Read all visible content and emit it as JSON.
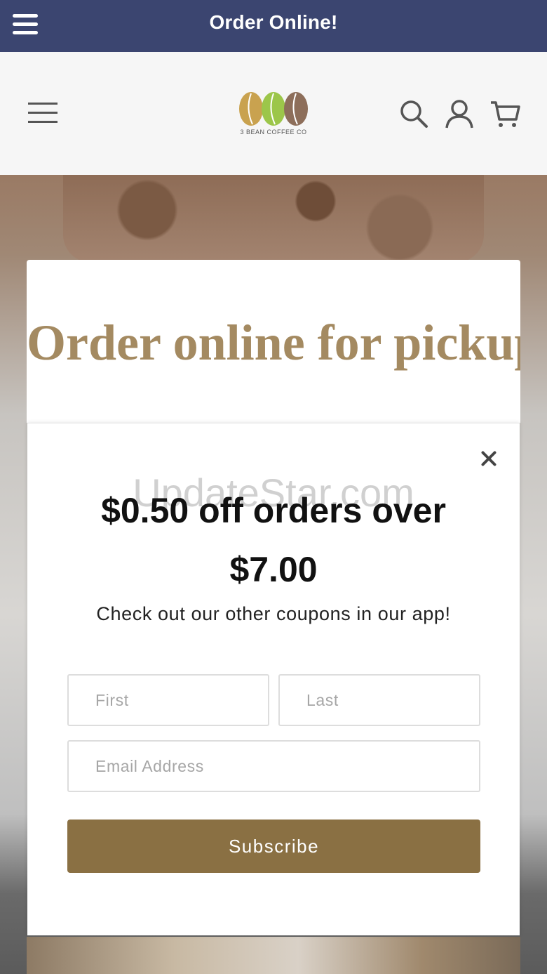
{
  "appbar": {
    "title": "Order Online!"
  },
  "header": {
    "logo_text": "3 BEAN COFFEE CO",
    "colors": {
      "bean_left": "#c9a24f",
      "bean_mid": "#9cc64a",
      "bean_right": "#8d6e5a"
    }
  },
  "hero": {
    "heading": "Order online for pickup."
  },
  "popup": {
    "watermark": "UpdateStar.com",
    "headline": "$0.50 off orders over $7.00",
    "subtext": "Check out our other coupons in our app!",
    "first_placeholder": "First",
    "last_placeholder": "Last",
    "email_placeholder": "Email Address",
    "subscribe_label": "Subscribe",
    "colors": {
      "button": "#8a7043",
      "heading_gold": "#a48a61"
    }
  },
  "icons": {
    "appbar_menu": "menu-icon",
    "header_menu": "hamburger-icon",
    "search": "search-icon",
    "account": "user-icon",
    "cart": "cart-icon",
    "close": "close-icon"
  }
}
